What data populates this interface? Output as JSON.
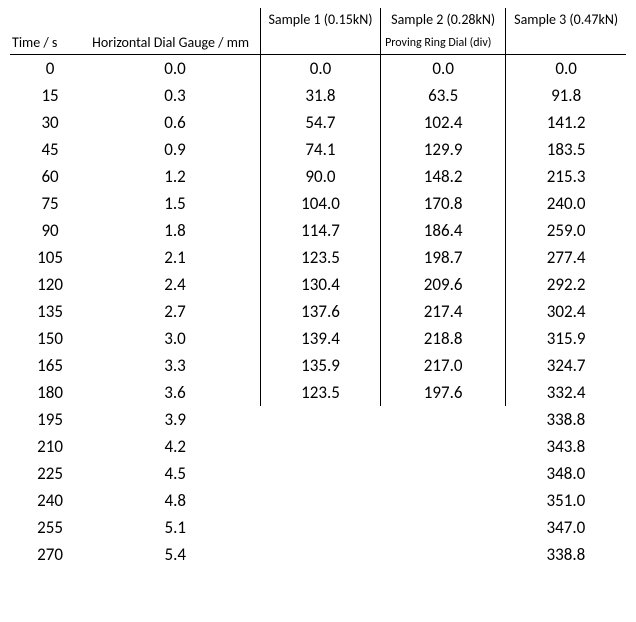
{
  "headers": {
    "sample1": "Sample 1 (0.15kN)",
    "sample2": "Sample 2 (0.28kN)",
    "sample3": "Sample 3 (0.47kN)",
    "time": "Time / s",
    "gauge": "Horizontal Dial Gauge / mm",
    "proving": "Proving Ring Dial (div)"
  },
  "rows": [
    {
      "time": "0",
      "gauge": "0.0",
      "s1": "0.0",
      "s2": "0.0",
      "s3": "0.0"
    },
    {
      "time": "15",
      "gauge": "0.3",
      "s1": "31.8",
      "s2": "63.5",
      "s3": "91.8"
    },
    {
      "time": "30",
      "gauge": "0.6",
      "s1": "54.7",
      "s2": "102.4",
      "s3": "141.2"
    },
    {
      "time": "45",
      "gauge": "0.9",
      "s1": "74.1",
      "s2": "129.9",
      "s3": "183.5"
    },
    {
      "time": "60",
      "gauge": "1.2",
      "s1": "90.0",
      "s2": "148.2",
      "s3": "215.3"
    },
    {
      "time": "75",
      "gauge": "1.5",
      "s1": "104.0",
      "s2": "170.8",
      "s3": "240.0"
    },
    {
      "time": "90",
      "gauge": "1.8",
      "s1": "114.7",
      "s2": "186.4",
      "s3": "259.0"
    },
    {
      "time": "105",
      "gauge": "2.1",
      "s1": "123.5",
      "s2": "198.7",
      "s3": "277.4"
    },
    {
      "time": "120",
      "gauge": "2.4",
      "s1": "130.4",
      "s2": "209.6",
      "s3": "292.2"
    },
    {
      "time": "135",
      "gauge": "2.7",
      "s1": "137.6",
      "s2": "217.4",
      "s3": "302.4"
    },
    {
      "time": "150",
      "gauge": "3.0",
      "s1": "139.4",
      "s2": "218.8",
      "s3": "315.9"
    },
    {
      "time": "165",
      "gauge": "3.3",
      "s1": "135.9",
      "s2": "217.0",
      "s3": "324.7"
    },
    {
      "time": "180",
      "gauge": "3.6",
      "s1": "123.5",
      "s2": "197.6",
      "s3": "332.4"
    },
    {
      "time": "195",
      "gauge": "3.9",
      "s1": "",
      "s2": "",
      "s3": "338.8"
    },
    {
      "time": "210",
      "gauge": "4.2",
      "s1": "",
      "s2": "",
      "s3": "343.8"
    },
    {
      "time": "225",
      "gauge": "4.5",
      "s1": "",
      "s2": "",
      "s3": "348.0"
    },
    {
      "time": "240",
      "gauge": "4.8",
      "s1": "",
      "s2": "",
      "s3": "351.0"
    },
    {
      "time": "255",
      "gauge": "5.1",
      "s1": "",
      "s2": "",
      "s3": "347.0"
    },
    {
      "time": "270",
      "gauge": "5.4",
      "s1": "",
      "s2": "",
      "s3": "338.8"
    }
  ],
  "s1_cutoff_index": 13,
  "s2_cutoff_index": 13
}
